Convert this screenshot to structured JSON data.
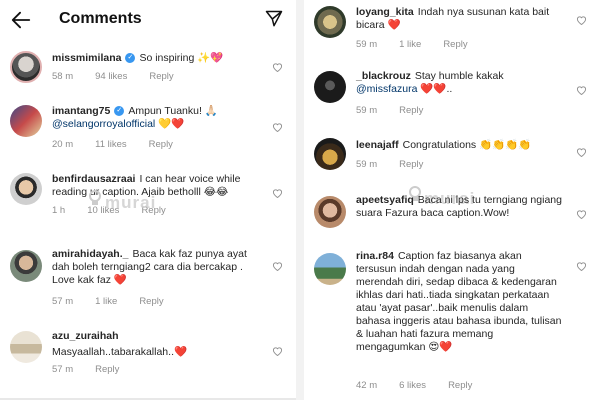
{
  "header": {
    "title": "Comments"
  },
  "watermark": "murai",
  "left_comments": [
    {
      "username": "missmimilana",
      "verified": true,
      "text": "So inspiring ✨💖",
      "mention": "",
      "time": "58 m",
      "likes": "94 likes",
      "reply": "Reply"
    },
    {
      "username": "imantang75",
      "verified": true,
      "text": "Ampun Tuanku! 🙏🏻",
      "mention": "@selangorroyalofficial",
      "text2": " 💛❤️",
      "time": "20 m",
      "likes": "11 likes",
      "reply": "Reply"
    },
    {
      "username": "benfirdausazraai",
      "verified": false,
      "text": "I can hear voice while reading ur caption. Ajaib betholll 😂😂",
      "mention": "",
      "time": "1 h",
      "likes": "10 likes",
      "reply": "Reply"
    },
    {
      "username": "amirahidayah._",
      "verified": false,
      "text": "Baca kak faz punya ayat dah boleh terngiang2 cara dia bercakap . Love kak faz ❤️",
      "mention": "",
      "time": "57 m",
      "likes": "1 like",
      "reply": "Reply"
    },
    {
      "username": "azu_zuraihah",
      "verified": false,
      "text": "Masyaallah..tabarakallah..❤️",
      "mention": "",
      "time": "57 m",
      "likes": "",
      "reply": "Reply"
    }
  ],
  "right_comments": [
    {
      "username": "loyang_kita",
      "text": "Indah nya susunan kata bait bicara ❤️",
      "mention": "",
      "time": "59 m",
      "likes": "1 like",
      "reply": "Reply"
    },
    {
      "username": "_blackrouz",
      "text": "Stay humble kakak",
      "mention": "@missfazura",
      "text2": " ❤️❤️..",
      "time": "59 m",
      "likes": "",
      "reply": "Reply"
    },
    {
      "username": "leenajaff",
      "text": "Congratulations 👏👏👏👏",
      "mention": "",
      "time": "59 m",
      "likes": "",
      "reply": "Reply"
    },
    {
      "username": "apeetsyafiq",
      "text": "Baca ni lps tu terngiang ngiang suara Fazura baca caption.Wow!",
      "mention": "",
      "time": "59 m",
      "likes": "",
      "reply": "Reply"
    },
    {
      "username": "rina.r84",
      "text": "Caption faz biasanya akan tersusun indah dengan nada yang merendah diri, sedap dibaca & kedengaran ikhlas dari hati..tiada singkatan perkataan atau 'ayat pasar'..baik menulis dalam bahasa inggeris atau bahasa ibunda, tulisan & luahan hati fazura memang mengagumkan 😍❤️",
      "mention": "",
      "time": "42 m",
      "likes": "6 likes",
      "reply": "Reply"
    }
  ],
  "colors": {
    "text": "#262626",
    "meta": "#8e8e8e",
    "verified": "#3897f0",
    "mention": "#003569"
  }
}
